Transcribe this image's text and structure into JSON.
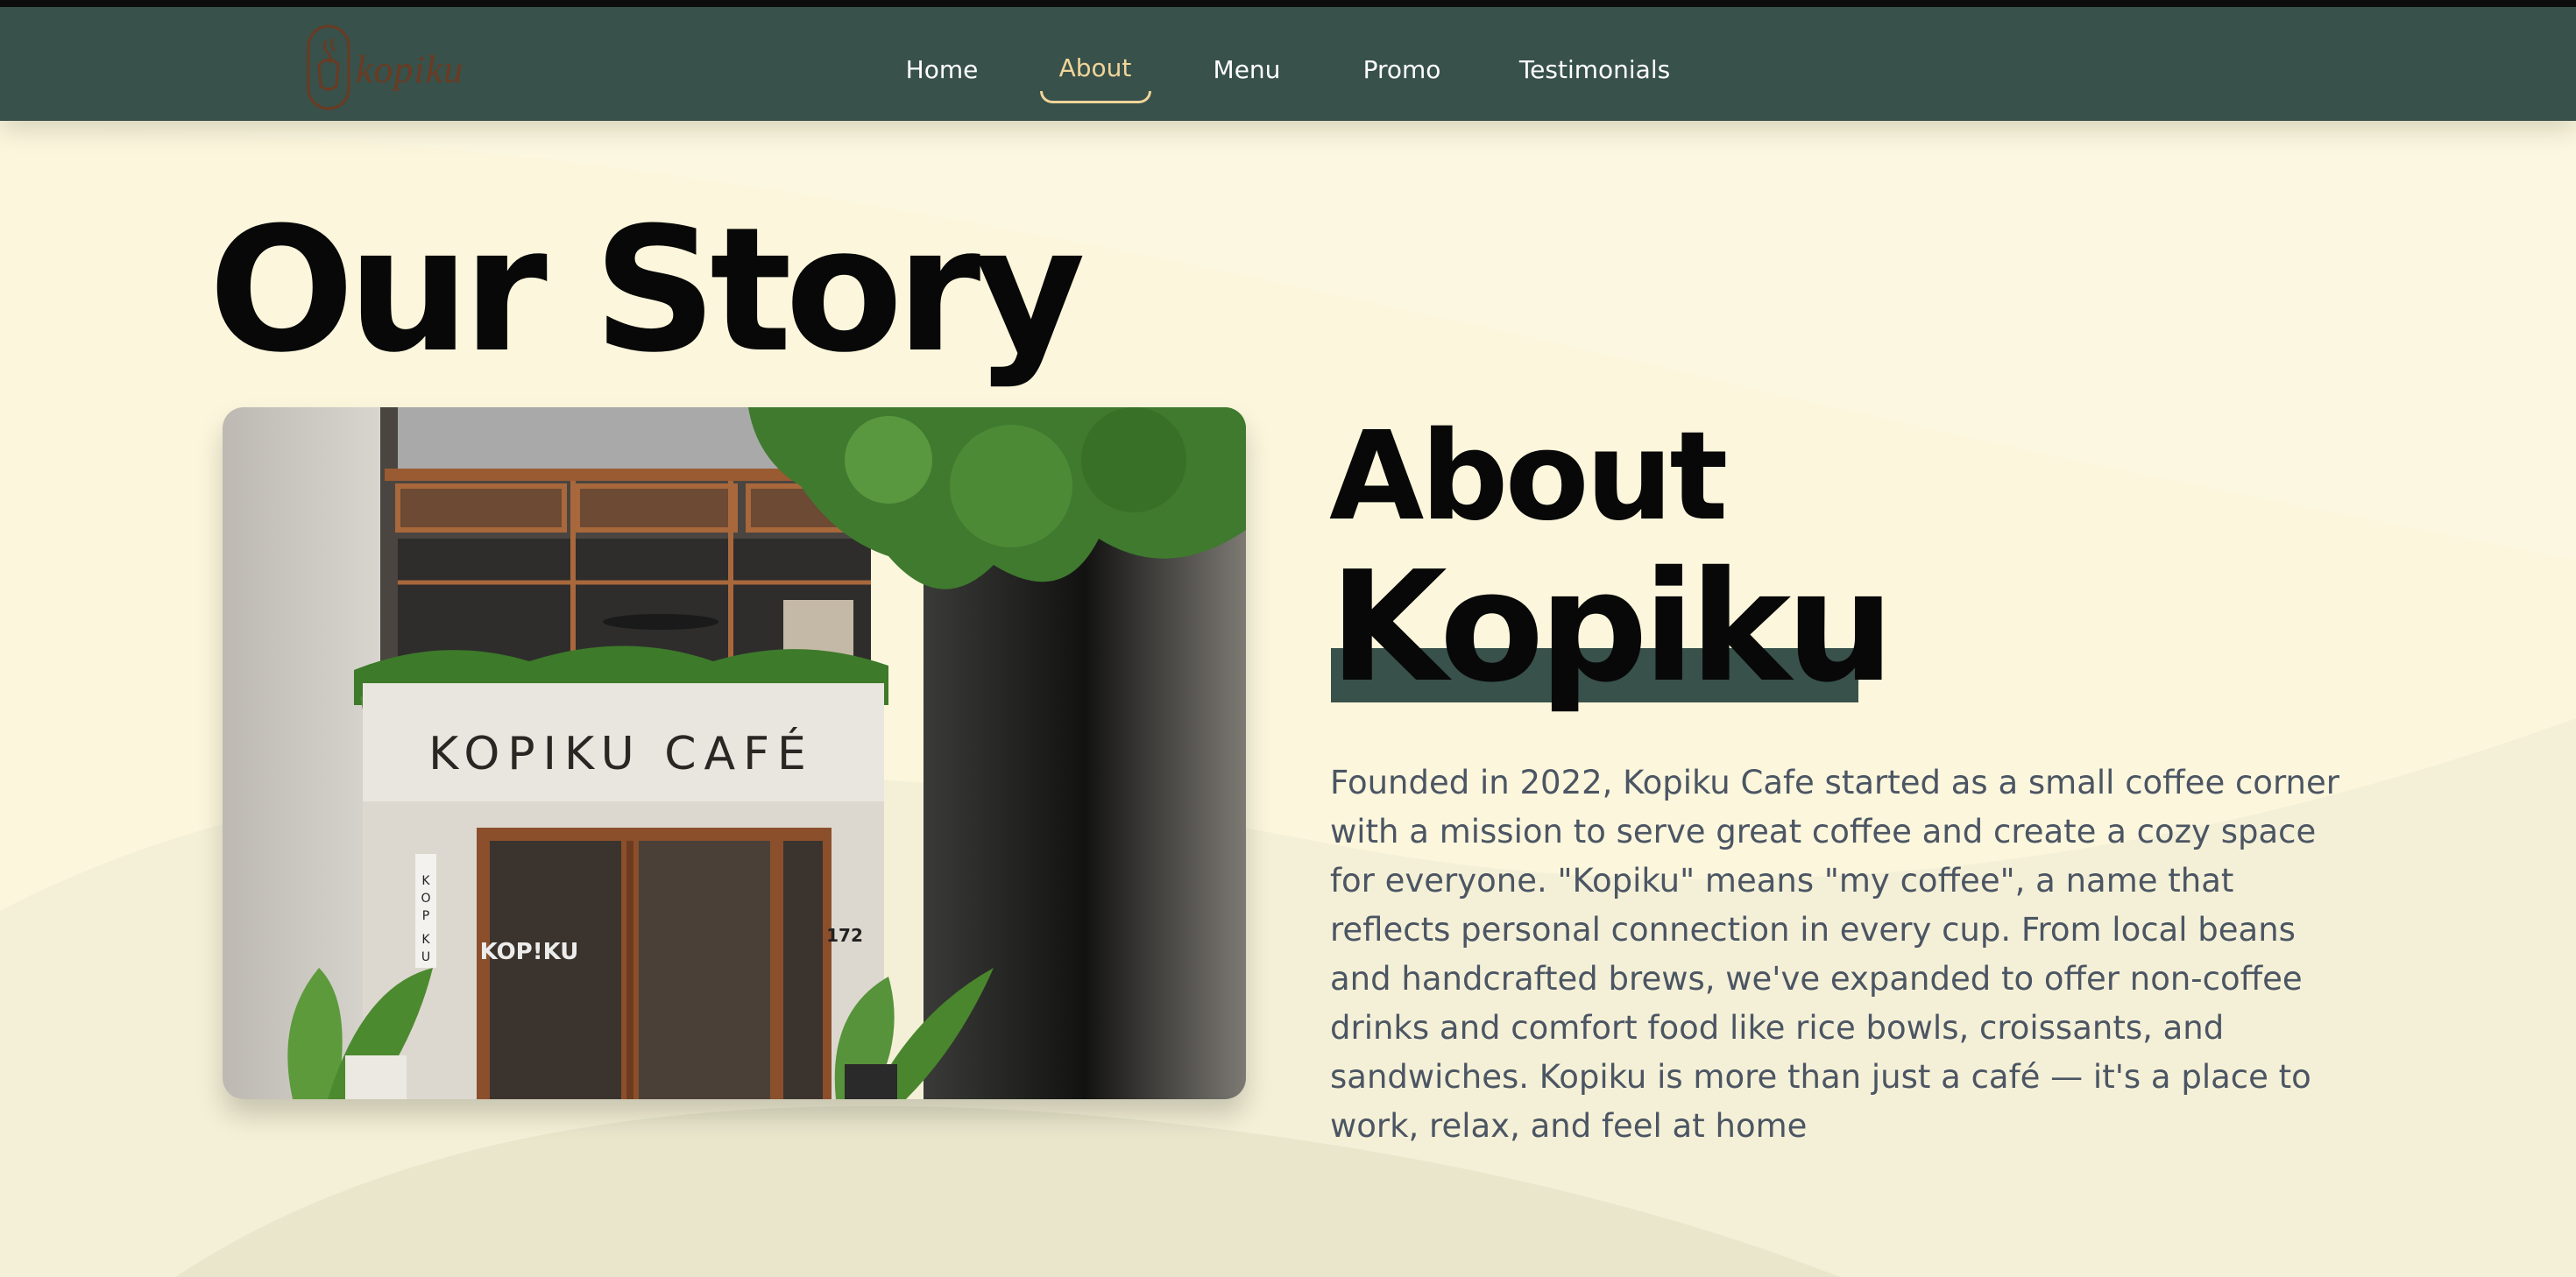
{
  "brand": {
    "logo_text": "kopiku"
  },
  "nav": {
    "items": [
      {
        "label": "Home"
      },
      {
        "label": "About"
      },
      {
        "label": "Menu"
      },
      {
        "label": "Promo"
      },
      {
        "label": "Testimonials"
      }
    ],
    "active_label": "About"
  },
  "story": {
    "heading": "Our Story"
  },
  "about": {
    "heading_line1": "About",
    "heading_line2": "Kopiku",
    "paragraph": "Founded in 2022, Kopiku Cafe started as a small coffee corner with a mission to serve great coffee and create a cozy space for everyone. \"Kopiku\" means \"my coffee\", a name that reflects personal connection in every cup. From local beans and handcrafted brews, we've expanded to offer non-coffee drinks and comfort food like rice bowls, croissants, and sandwiches. Kopiku is more than just a café — it's a place to work, relax, and feel at home"
  },
  "photo": {
    "sign_text": "KOPIKU CAFÉ",
    "vertical_sign": "KOP KU",
    "door_logo": "KOP!KU",
    "house_number": "172"
  },
  "colors": {
    "nav_bg": "#38514a",
    "page_bg": "#fbf6dc",
    "accent": "#f1d59a",
    "highlight": "#38514a",
    "body_text": "#4b5563"
  },
  "icons": {
    "logo": "coffee-cup-emblem-icon"
  }
}
